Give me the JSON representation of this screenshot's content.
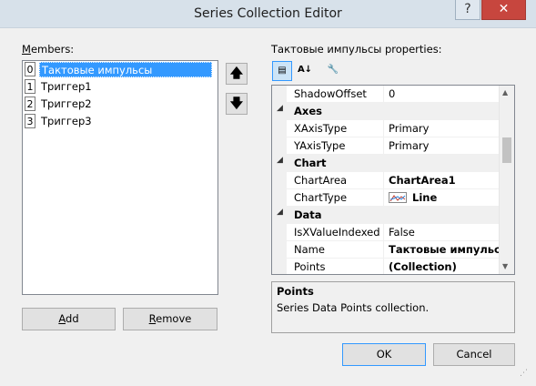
{
  "window": {
    "title": "Series Collection Editor",
    "help_glyph": "?",
    "close_glyph": "✕"
  },
  "members": {
    "label": "Members:",
    "items": [
      {
        "index": "0",
        "name": "Тактовые импульсы",
        "selected": true
      },
      {
        "index": "1",
        "name": "Триггер1",
        "selected": false
      },
      {
        "index": "2",
        "name": "Триггер2",
        "selected": false
      },
      {
        "index": "3",
        "name": "Триггер3",
        "selected": false
      }
    ],
    "up_glyph": "🡅",
    "down_glyph": "🡇",
    "add_label": "Add",
    "remove_label": "Remove"
  },
  "properties": {
    "label": "Тактовые импульсы properties:",
    "toolbar": {
      "categorized_glyph": "▤",
      "alpha_glyph": "A↓",
      "pages_glyph": "🔧"
    },
    "rows": [
      {
        "name": "ShadowOffset",
        "value": "0"
      },
      {
        "category": "Axes"
      },
      {
        "name": "XAxisType",
        "value": "Primary"
      },
      {
        "name": "YAxisType",
        "value": "Primary"
      },
      {
        "category": "Chart"
      },
      {
        "name": "ChartArea",
        "value": "ChartArea1"
      },
      {
        "name": "ChartType",
        "value": "Line"
      },
      {
        "category": "Data"
      },
      {
        "name": "IsXValueIndexed",
        "value": "False"
      },
      {
        "name": "Name",
        "value": "Тактовые импульсы"
      },
      {
        "name": "Points",
        "value": "(Collection)"
      }
    ],
    "description": {
      "title": "Points",
      "text": "Series Data Points collection."
    }
  },
  "footer": {
    "ok_label": "OK",
    "cancel_label": "Cancel"
  },
  "colors": {
    "selection": "#3399ff",
    "close_button": "#c7463e",
    "titlebar": "#d7e1ea"
  }
}
